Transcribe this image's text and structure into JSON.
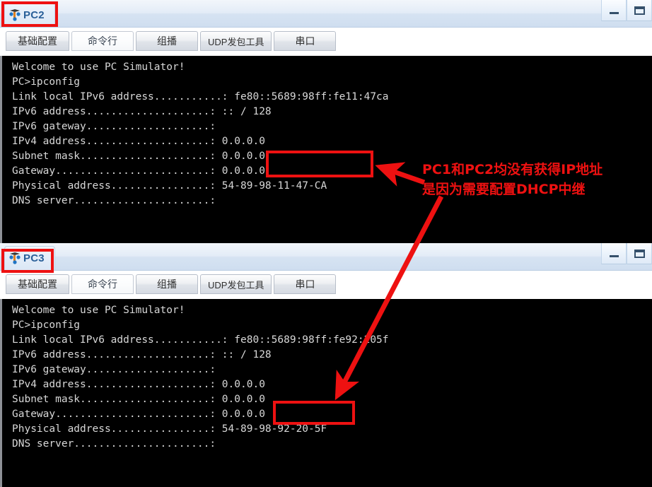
{
  "windows": [
    {
      "title": "PC2",
      "icon": "pc-simulator-icon",
      "buttons": {
        "minimize": "minimize-button",
        "maximize": "maximize-button"
      },
      "tabs": [
        {
          "label": "基础配置",
          "active": false
        },
        {
          "label": "命令行",
          "active": true
        },
        {
          "label": "组播",
          "active": false
        },
        {
          "label": "UDP发包工具",
          "active": false
        },
        {
          "label": "串口",
          "active": false
        }
      ],
      "terminal": [
        "Welcome to use PC Simulator!",
        "",
        "PC>ipconfig",
        "",
        "Link local IPv6 address...........: fe80::5689:98ff:fe11:47ca",
        "IPv6 address....................: :: / 128",
        "IPv6 gateway....................:",
        "IPv4 address....................: 0.0.0.0",
        "Subnet mask.....................: 0.0.0.0",
        "Gateway.........................: 0.0.0.0",
        "Physical address................: 54-89-98-11-47-CA",
        "DNS server......................:"
      ]
    },
    {
      "title": "PC3",
      "icon": "pc-simulator-icon",
      "buttons": {
        "minimize": "minimize-button",
        "maximize": "maximize-button"
      },
      "tabs": [
        {
          "label": "基础配置",
          "active": false
        },
        {
          "label": "命令行",
          "active": true
        },
        {
          "label": "组播",
          "active": false
        },
        {
          "label": "UDP发包工具",
          "active": false
        },
        {
          "label": "串口",
          "active": false
        }
      ],
      "terminal": [
        "Welcome to use PC Simulator!",
        "",
        "PC>ipconfig",
        "",
        "Link local IPv6 address...........: fe80::5689:98ff:fe92:205f",
        "IPv6 address....................: :: / 128",
        "IPv6 gateway....................:",
        "IPv4 address....................: 0.0.0.0",
        "Subnet mask.....................: 0.0.0.0",
        "Gateway.........................: 0.0.0.0",
        "Physical address................: 54-89-98-92-20-5F",
        "DNS server......................:"
      ]
    }
  ],
  "annotations": {
    "color": "#ee1111",
    "note_line1": "PC1和PC2均没有获得IP地址",
    "note_line2": "是因为需要配置DHCP中继",
    "highlights": [
      "pc2-title-highlight",
      "pc2-ipv4-highlight",
      "pc3-title-highlight",
      "pc3-ipv4-highlight"
    ],
    "arrows": [
      "arrow-to-pc2-ipv4",
      "arrow-to-pc3-ipv4"
    ]
  }
}
